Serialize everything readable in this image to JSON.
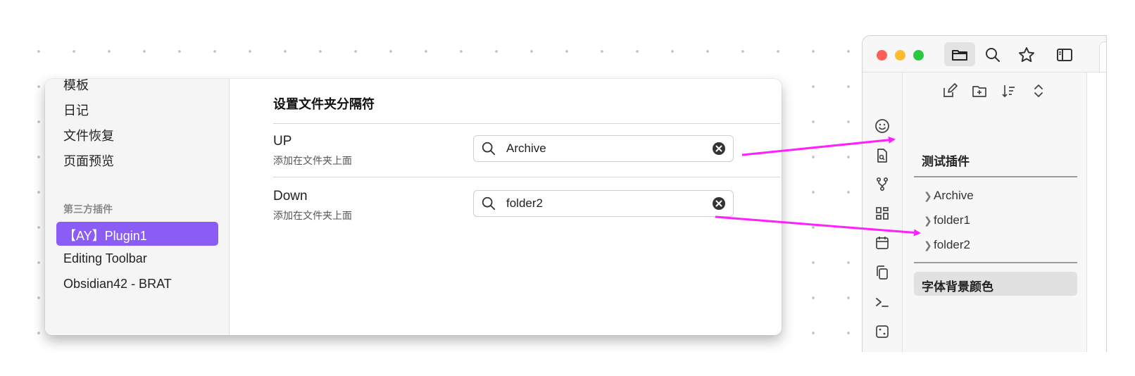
{
  "settings": {
    "nav": {
      "templates": "模板",
      "daily": "日记",
      "file_recovery": "文件恢复",
      "page_preview": "页面预览",
      "third_party_heading": "第三方插件",
      "plugin_active": "【AY】Plugin1",
      "editing_toolbar": "Editing Toolbar",
      "brat": "Obsidian42 - BRAT"
    },
    "section_title": "设置文件夹分隔符",
    "up": {
      "name": "UP",
      "desc": "添加在文件夹上面",
      "value": "Archive"
    },
    "down": {
      "name": "Down",
      "desc": "添加在文件夹上面",
      "value": "folder2"
    }
  },
  "obsidian": {
    "window_controls": {
      "close": "#ff5f57",
      "minimize": "#febc2e",
      "zoom": "#28c840"
    },
    "toolbar_icons": [
      "folder-icon",
      "search-icon",
      "star-icon",
      "sidebar-toggle-icon"
    ],
    "ribbon_icons": [
      "smiley-icon",
      "file-search-icon",
      "git-branch-icon",
      "grid-icon",
      "calendar-icon",
      "copy-icon",
      "terminal-icon",
      "dice-icon"
    ],
    "explorer_actions": [
      "new-note-icon",
      "new-folder-icon",
      "sort-icon",
      "collapse-icon"
    ],
    "separator_label": "测试插件",
    "tree": [
      "Archive",
      "folder1",
      "folder2"
    ],
    "selected_item": "字体背景颜色"
  },
  "colors": {
    "accent": "#8b5cf6",
    "arrow": "#ff1fff"
  }
}
